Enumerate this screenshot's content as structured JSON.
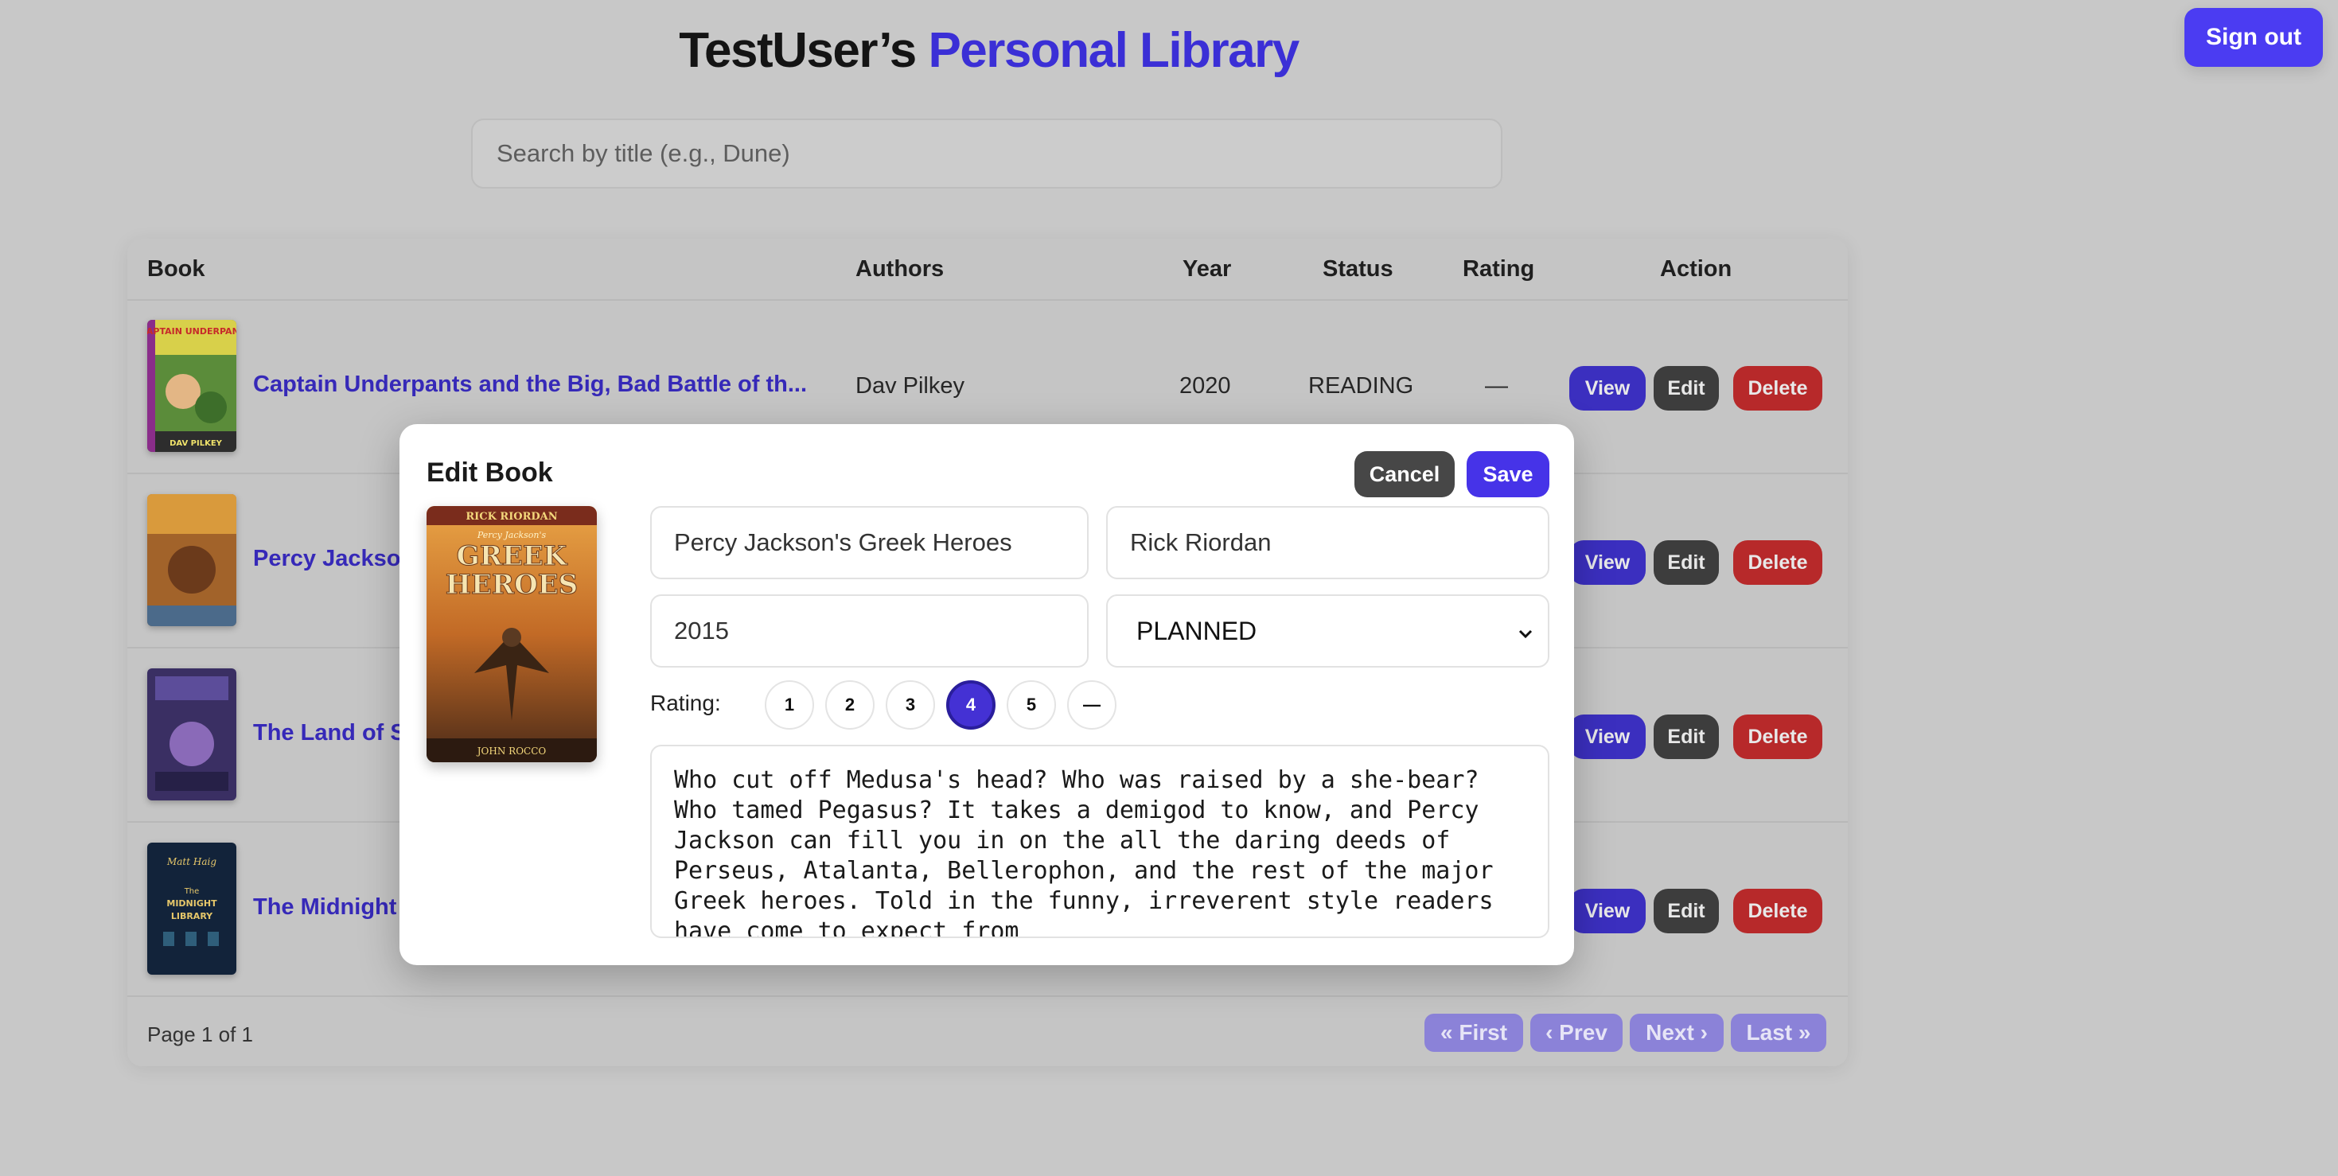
{
  "header": {
    "title_prefix": "TestUser’s",
    "title_accent": "Personal Library",
    "signout_label": "Sign out"
  },
  "search": {
    "placeholder": "Search by title (e.g., Dune)"
  },
  "table": {
    "columns": [
      "Book",
      "Authors",
      "Year",
      "Status",
      "Rating",
      "Action"
    ],
    "rows": [
      {
        "title": "Captain Underpants and the Big, Bad Battle of th...",
        "authors": "Dav Pilkey",
        "year": "2020",
        "status": "READING",
        "rating": "—"
      },
      {
        "title": "Percy Jackso",
        "authors": "",
        "year": "",
        "status": "",
        "rating": ""
      },
      {
        "title": "The Land of S",
        "authors": "",
        "year": "",
        "status": "",
        "rating": ""
      },
      {
        "title": "The Midnight",
        "authors": "",
        "year": "",
        "status": "",
        "rating": ""
      }
    ],
    "actions": {
      "view": "View",
      "edit": "Edit",
      "delete": "Delete"
    },
    "footer": {
      "page_info": "Page 1 of 1",
      "first": "« First",
      "prev": "‹ Prev",
      "next": "Next ›",
      "last": "Last »"
    }
  },
  "modal": {
    "title": "Edit Book",
    "cancel_label": "Cancel",
    "save_label": "Save",
    "title_value": "Percy Jackson's Greek Heroes",
    "author_value": "Rick Riordan",
    "year_value": "2015",
    "status_value": "PLANNED",
    "rating_label": "Rating:",
    "rating_options": [
      "1",
      "2",
      "3",
      "4",
      "5",
      "—"
    ],
    "selected_rating": "4",
    "description": "Who cut off Medusa's head? Who was raised by a she-bear? Who tamed Pegasus? It takes a demigod to know, and Percy Jackson can fill you in on the all the daring deeds of Perseus, Atalanta, Bellerophon, and the rest of the major Greek heroes. Told in the funny, irreverent style readers have come to expect from"
  },
  "covers": {
    "row1": {
      "lettering": "CAPTAIN UNDERPANTS",
      "sub": "DAV PILKEY"
    },
    "modal": {
      "top": "RICK RIORDAN",
      "mid": "Percy Jackson's",
      "main1": "GREEK",
      "main2": "HEROES",
      "bottom": "JOHN ROCCO"
    },
    "row4": {
      "author": "Matt Haig",
      "line1": "The",
      "line2": "MIDNIGHT",
      "line3": "LIBRARY"
    }
  },
  "colors": {
    "accent": "#3b2fd6",
    "view_button": "#3b2fbf",
    "delete_button": "#b7292a",
    "save_button": "#4633e8"
  }
}
